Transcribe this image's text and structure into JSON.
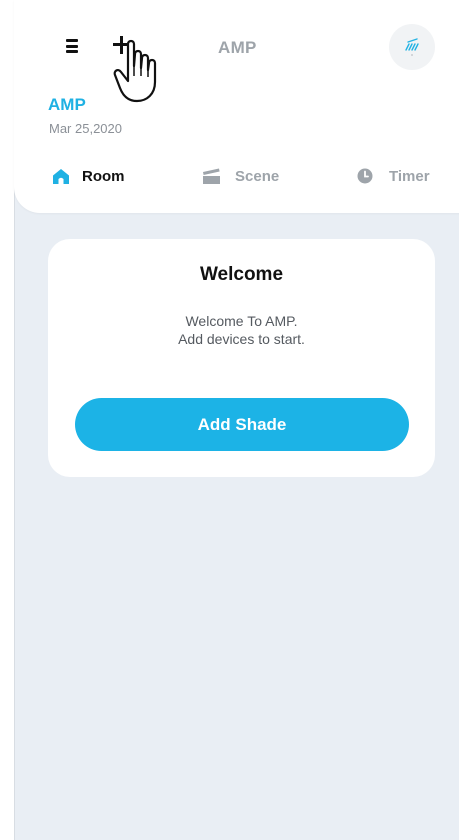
{
  "header": {
    "title": "AMP",
    "home_name": "AMP",
    "home_date": "Mar 25,2020"
  },
  "tabs": [
    {
      "label": "Room",
      "icon": "home-icon",
      "active": true
    },
    {
      "label": "Scene",
      "icon": "clapperboard-icon",
      "active": false
    },
    {
      "label": "Timer",
      "icon": "clock-icon",
      "active": false
    }
  ],
  "welcome_card": {
    "title": "Welcome",
    "message_line1": "Welcome To AMP.",
    "message_line2": "Add devices to start.",
    "button_label": "Add Shade"
  },
  "colors": {
    "accent": "#1cb3e6",
    "background": "#e9eef4",
    "inactive_text": "#9ea4aa"
  }
}
